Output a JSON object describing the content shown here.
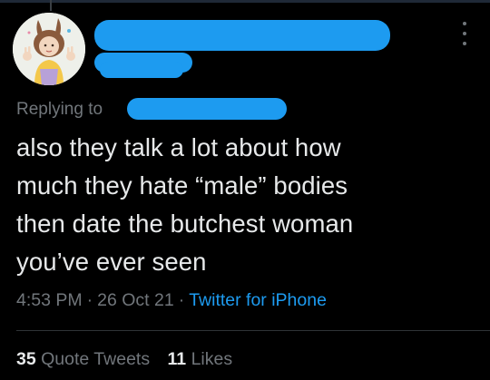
{
  "reply": {
    "label": "Replying to"
  },
  "tweet": {
    "lines": [
      "also they talk a lot about how",
      "much they hate “male” bodies",
      "then date the butchest woman",
      "you’ve ever seen"
    ],
    "time": "4:53 PM",
    "date": "26 Oct 21",
    "separator": "·",
    "source": "Twitter for iPhone"
  },
  "stats": {
    "quote_tweets_count": "35",
    "quote_tweets_label": "Quote Tweets",
    "likes_count": "11",
    "likes_label": "Likes"
  },
  "colors": {
    "background": "#000000",
    "text": "#e7e9ea",
    "muted": "#71767b",
    "accent": "#1d9bf0"
  },
  "icons": {
    "more": "more-options-icon"
  }
}
